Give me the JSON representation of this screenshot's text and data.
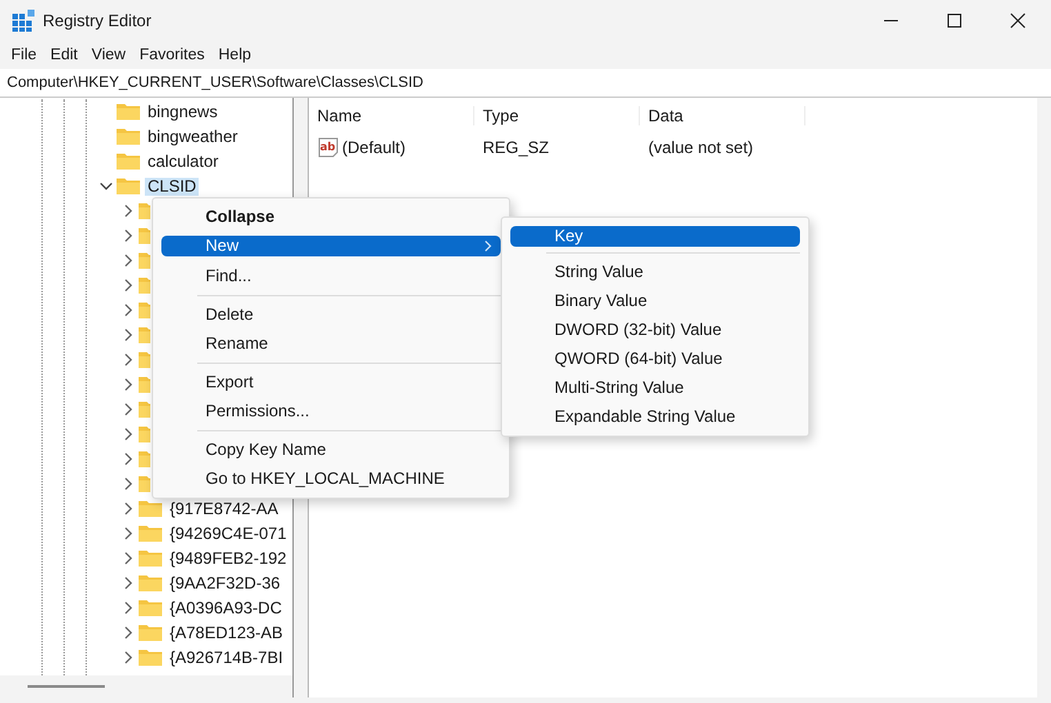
{
  "window": {
    "title": "Registry Editor"
  },
  "menu_bar": [
    "File",
    "Edit",
    "View",
    "Favorites",
    "Help"
  ],
  "address": "Computer\\HKEY_CURRENT_USER\\Software\\Classes\\CLSID",
  "tree": [
    {
      "label": "bingnews",
      "selected": false
    },
    {
      "label": "bingweather",
      "selected": false
    },
    {
      "label": "calculator",
      "selected": false
    },
    {
      "label": "CLSID",
      "selected": true,
      "expanded": true,
      "children": [
        {
          "expanded": false
        },
        {
          "expanded": false
        },
        {
          "expanded": false
        },
        {
          "expanded": false
        },
        {
          "expanded": false
        },
        {
          "expanded": false
        },
        {
          "expanded": false
        },
        {
          "expanded": false
        },
        {
          "expanded": false
        },
        {
          "expanded": false
        },
        {
          "expanded": false
        },
        {
          "expanded": false
        },
        {
          "label": "{917E8742-AA",
          "expanded": false
        },
        {
          "label": "{94269C4E-071",
          "expanded": false
        },
        {
          "label": "{9489FEB2-192",
          "expanded": false
        },
        {
          "label": "{9AA2F32D-36",
          "expanded": false
        },
        {
          "label": "{A0396A93-DC",
          "expanded": false
        },
        {
          "label": "{A78ED123-AB",
          "expanded": false
        },
        {
          "label": "{A926714B-7BI",
          "expanded": false
        }
      ]
    }
  ],
  "values": {
    "columns": [
      "Name",
      "Type",
      "Data"
    ],
    "rows": [
      {
        "icon": "ab",
        "name": "(Default)",
        "type": "REG_SZ",
        "data": "(value not set)"
      }
    ]
  },
  "context_menu": [
    {
      "kind": "item",
      "label": "Collapse",
      "default": true,
      "selected": false
    },
    {
      "kind": "item",
      "label": "New",
      "submenu": true,
      "selected": true
    },
    {
      "kind": "item",
      "label": "Find...",
      "selected": false
    },
    {
      "kind": "separator"
    },
    {
      "kind": "item",
      "label": "Delete",
      "selected": false
    },
    {
      "kind": "item",
      "label": "Rename",
      "selected": false
    },
    {
      "kind": "separator"
    },
    {
      "kind": "item",
      "label": "Export",
      "selected": false
    },
    {
      "kind": "item",
      "label": "Permissions...",
      "selected": false
    },
    {
      "kind": "separator"
    },
    {
      "kind": "item",
      "label": "Copy Key Name",
      "selected": false
    },
    {
      "kind": "item",
      "label": "Go to HKEY_LOCAL_MACHINE",
      "selected": false
    }
  ],
  "submenu": [
    {
      "kind": "item",
      "label": "Key",
      "selected": true
    },
    {
      "kind": "separator"
    },
    {
      "kind": "item",
      "label": "String Value",
      "selected": false
    },
    {
      "kind": "item",
      "label": "Binary Value",
      "selected": false
    },
    {
      "kind": "item",
      "label": "DWORD (32-bit) Value",
      "selected": false
    },
    {
      "kind": "item",
      "label": "QWORD (64-bit) Value",
      "selected": false
    },
    {
      "kind": "item",
      "label": "Multi-String Value",
      "selected": false
    },
    {
      "kind": "item",
      "label": "Expandable String Value",
      "selected": false
    }
  ]
}
